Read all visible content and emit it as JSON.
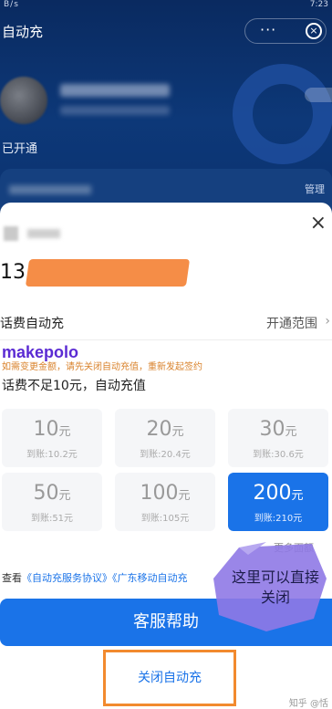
{
  "status_bar": {
    "left": "B/s",
    "time": "7:23"
  },
  "header": {
    "title": "自动充",
    "more_icon": "···",
    "close_icon": "⊗"
  },
  "account": {
    "status": "已开通",
    "manage": "管理"
  },
  "sheet": {
    "close_icon": "×",
    "phone_prefix": "13",
    "row_label": "话费自动充",
    "row_right": "开通范围",
    "watermark": "makepolo",
    "notice": "如需变更金额，请先关闭自动充值，重新发起签约",
    "subtitle": "话费不足10元，自动充值",
    "tiles": [
      {
        "amount": "10",
        "unit": "元",
        "pay": "到账:10.2元",
        "selected": false
      },
      {
        "amount": "20",
        "unit": "元",
        "pay": "到账:20.4元",
        "selected": false
      },
      {
        "amount": "30",
        "unit": "元",
        "pay": "到账:30.6元",
        "selected": false
      },
      {
        "amount": "50",
        "unit": "元",
        "pay": "到账:51元",
        "selected": false
      },
      {
        "amount": "100",
        "unit": "元",
        "pay": "到账:105元",
        "selected": false
      },
      {
        "amount": "200",
        "unit": "元",
        "pay": "到账:210元",
        "selected": true
      }
    ],
    "more_amounts": "更多面额",
    "agreement_prefix": "查看",
    "agreement_link1": "《自动充服务协议》",
    "agreement_link2": "《广东移动自动充",
    "help_button": "客服帮助",
    "close_auto_button": "关闭自动充",
    "annotation": "这里可以直接关闭",
    "footer": "知乎 @恬"
  },
  "colors": {
    "accent": "#1a73e8",
    "highlight": "#f28a2e",
    "notice": "#d9822b"
  }
}
